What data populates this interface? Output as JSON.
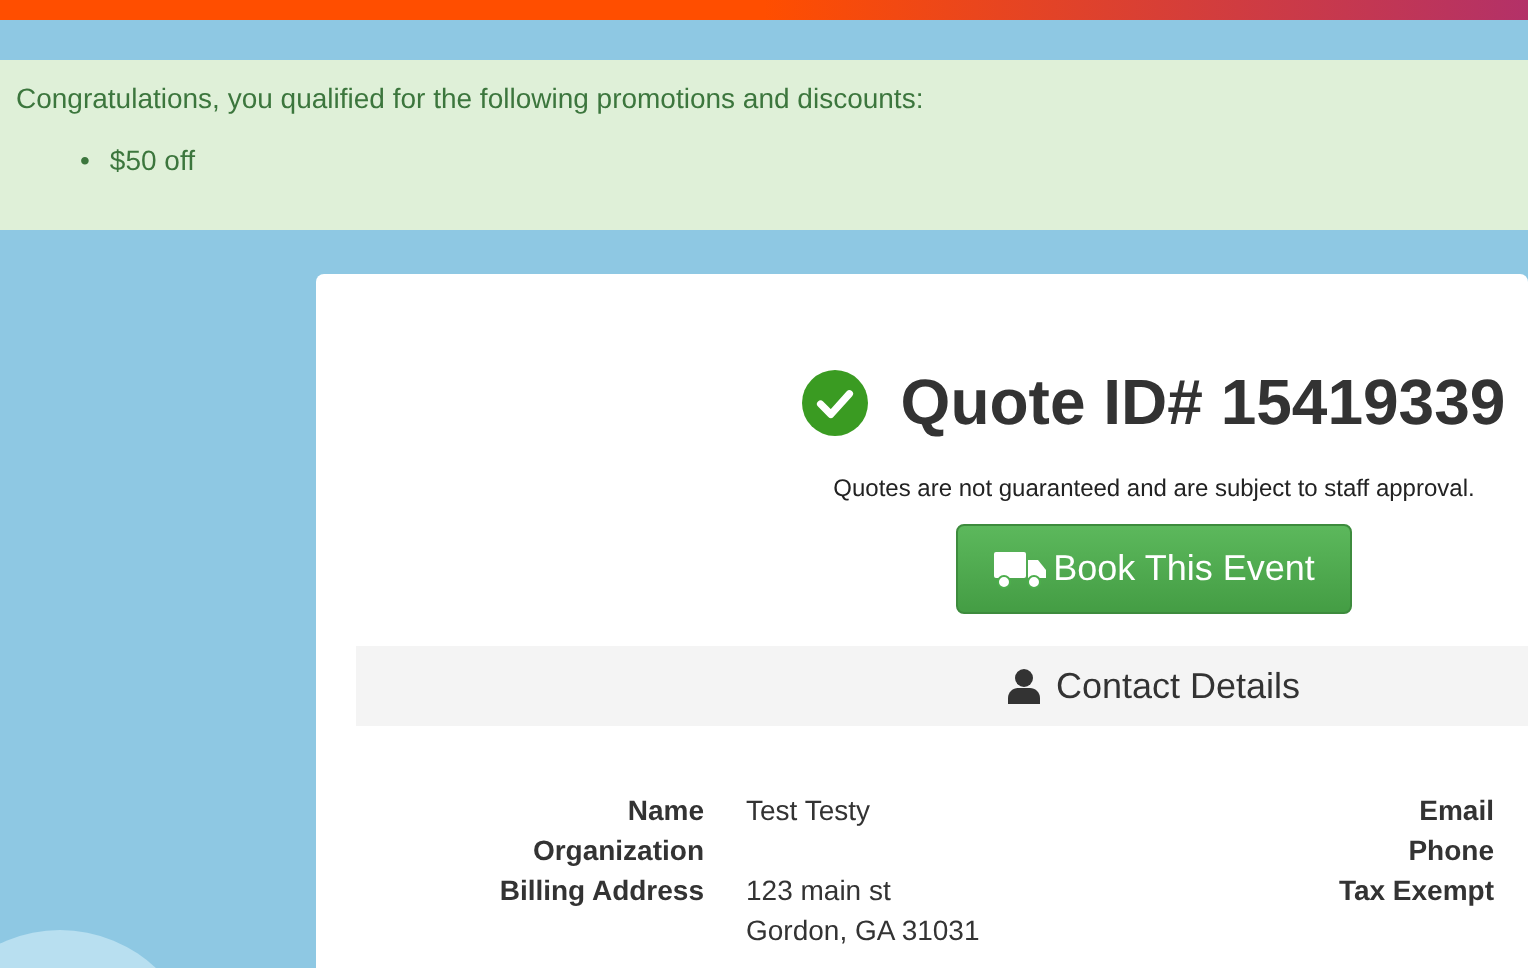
{
  "promotions": {
    "message": "Congratulations, you qualified for the following promotions and discounts:",
    "items": [
      {
        "marker": "•",
        "text": "$50 off"
      }
    ]
  },
  "quote": {
    "title": "Quote ID# 15419339",
    "approved": true,
    "note": "Quotes are not guaranteed and are subject to staff approval.",
    "book_button": "Book This Event"
  },
  "contact": {
    "heading": "Contact Details",
    "left": [
      {
        "label": "Name",
        "value": [
          "Test Testy"
        ]
      },
      {
        "label": "Organization"
      },
      {
        "label": "Billing Address",
        "value": [
          "123 main st",
          "Gordon, GA 31031"
        ]
      }
    ],
    "right": [
      {
        "label": "Email"
      },
      {
        "label": "Phone"
      },
      {
        "label": "Tax Exempt"
      }
    ]
  }
}
